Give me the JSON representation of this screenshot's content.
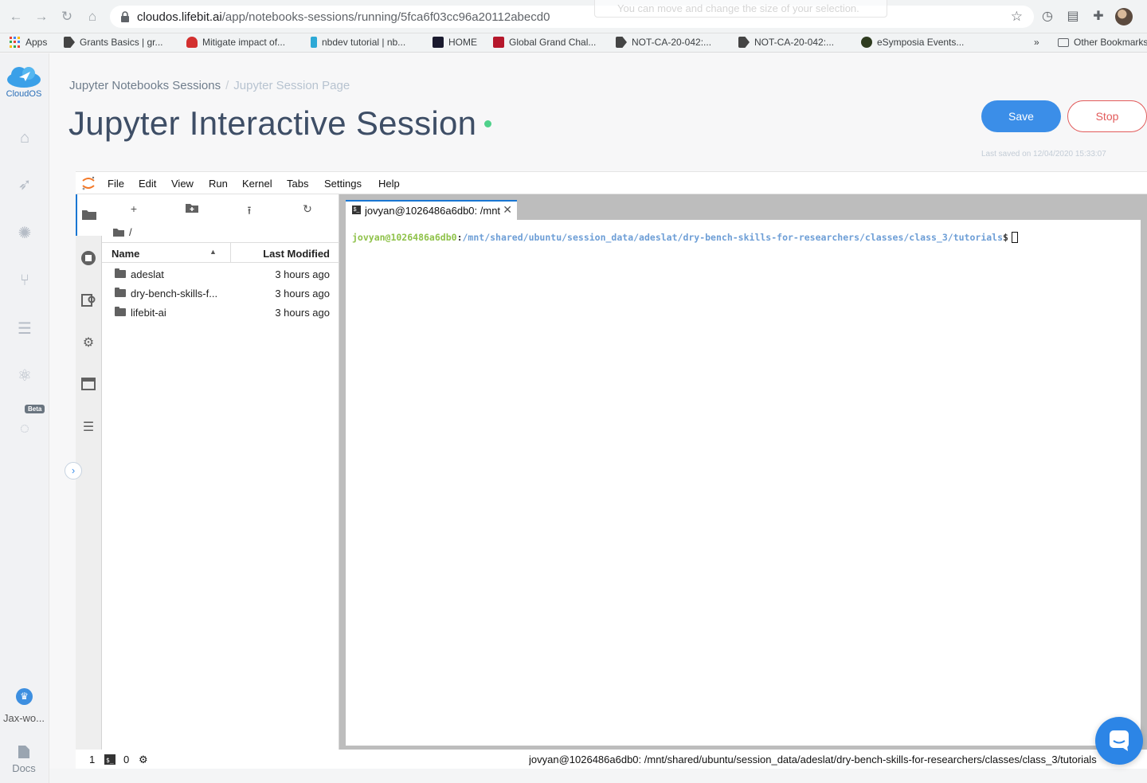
{
  "browser": {
    "url_host": "cloudos.lifebit.ai",
    "url_path": "/app/notebooks-sessions/running/5fca6f03cc96a20112abecd0",
    "tooltip_text": "You can move and change the size of your selection.",
    "bookmarks": [
      {
        "label": "Apps",
        "icon": "apps-grid-icon"
      },
      {
        "label": "Grants Basics | gr...",
        "icon": "arrow-tag-icon"
      },
      {
        "label": "Mitigate impact of...",
        "icon": "red-hat-icon"
      },
      {
        "label": "nbdev tutorial | nb...",
        "icon": "fastai-icon"
      },
      {
        "label": "HOME",
        "icon": "ncb-icon"
      },
      {
        "label": "Global Grand Chal...",
        "icon": "gc-icon"
      },
      {
        "label": "NOT-CA-20-042:...",
        "icon": "arrow-tag-icon"
      },
      {
        "label": "NOT-CA-20-042:...",
        "icon": "arrow-tag-icon"
      },
      {
        "label": "eSymposia Events...",
        "icon": "esymposia-icon"
      }
    ],
    "overflow_label": "»",
    "other_bookmarks": "Other Bookmarks"
  },
  "app": {
    "logo_text": "CloudOS",
    "beta_label": "Beta",
    "workspace_label": "Jax-wo...",
    "docs_label": "Docs",
    "breadcrumb": [
      "Jupyter Notebooks Sessions",
      "Jupyter Session Page"
    ],
    "breadcrumb_separator": "/",
    "title": "Jupyter Interactive Session",
    "save_label": "Save",
    "stop_label": "Stop",
    "last_saved": "Last saved on 12/04/2020 15:33:07",
    "colors": {
      "primary": "#3b8ee8",
      "danger": "#e25b5b",
      "status_running": "#4fd18b"
    }
  },
  "jupyter": {
    "menu": [
      "File",
      "Edit",
      "View",
      "Run",
      "Kernel",
      "Tabs",
      "Settings",
      "Help"
    ],
    "filebrowser": {
      "path": "/",
      "col_name": "Name",
      "col_modified": "Last Modified",
      "files": [
        {
          "name": "adeslat",
          "modified": "3 hours ago"
        },
        {
          "name": "dry-bench-skills-f...",
          "modified": "3 hours ago"
        },
        {
          "name": "lifebit-ai",
          "modified": "3 hours ago"
        }
      ]
    },
    "terminal": {
      "tab_label": "jovyan@1026486a6db0: /mnt",
      "user_host": "jovyan@1026486a6db0",
      "colon": ":",
      "path": "/mnt/shared/ubuntu/session_data/adeslat/dry-bench-skills-for-researchers/classes/class_3/tutorials",
      "prompt": "$"
    },
    "statusbar": {
      "count_terminals": "1",
      "count_kernels": "0",
      "right_text": "jovyan@1026486a6db0: /mnt/shared/ubuntu/session_data/adeslat/dry-bench-skills-for-researchers/classes/class_3/tutorials"
    }
  }
}
